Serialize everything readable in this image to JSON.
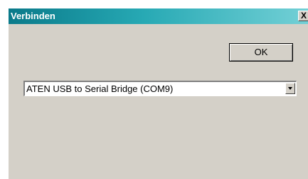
{
  "window": {
    "title": "Verbinden",
    "close_glyph": "X"
  },
  "dialog": {
    "ok_label": "OK",
    "port_select": {
      "selected_value": "ATEN USB to Serial Bridge (COM9)"
    }
  },
  "colors": {
    "dialog_background": "#d4d0c8",
    "titlebar_start": "#0a7a8a",
    "titlebar_end": "#73d0d6",
    "titlebar_text": "#ffffff"
  },
  "icons": {
    "close": "close-icon",
    "dropdown": "chevron-down-icon"
  }
}
